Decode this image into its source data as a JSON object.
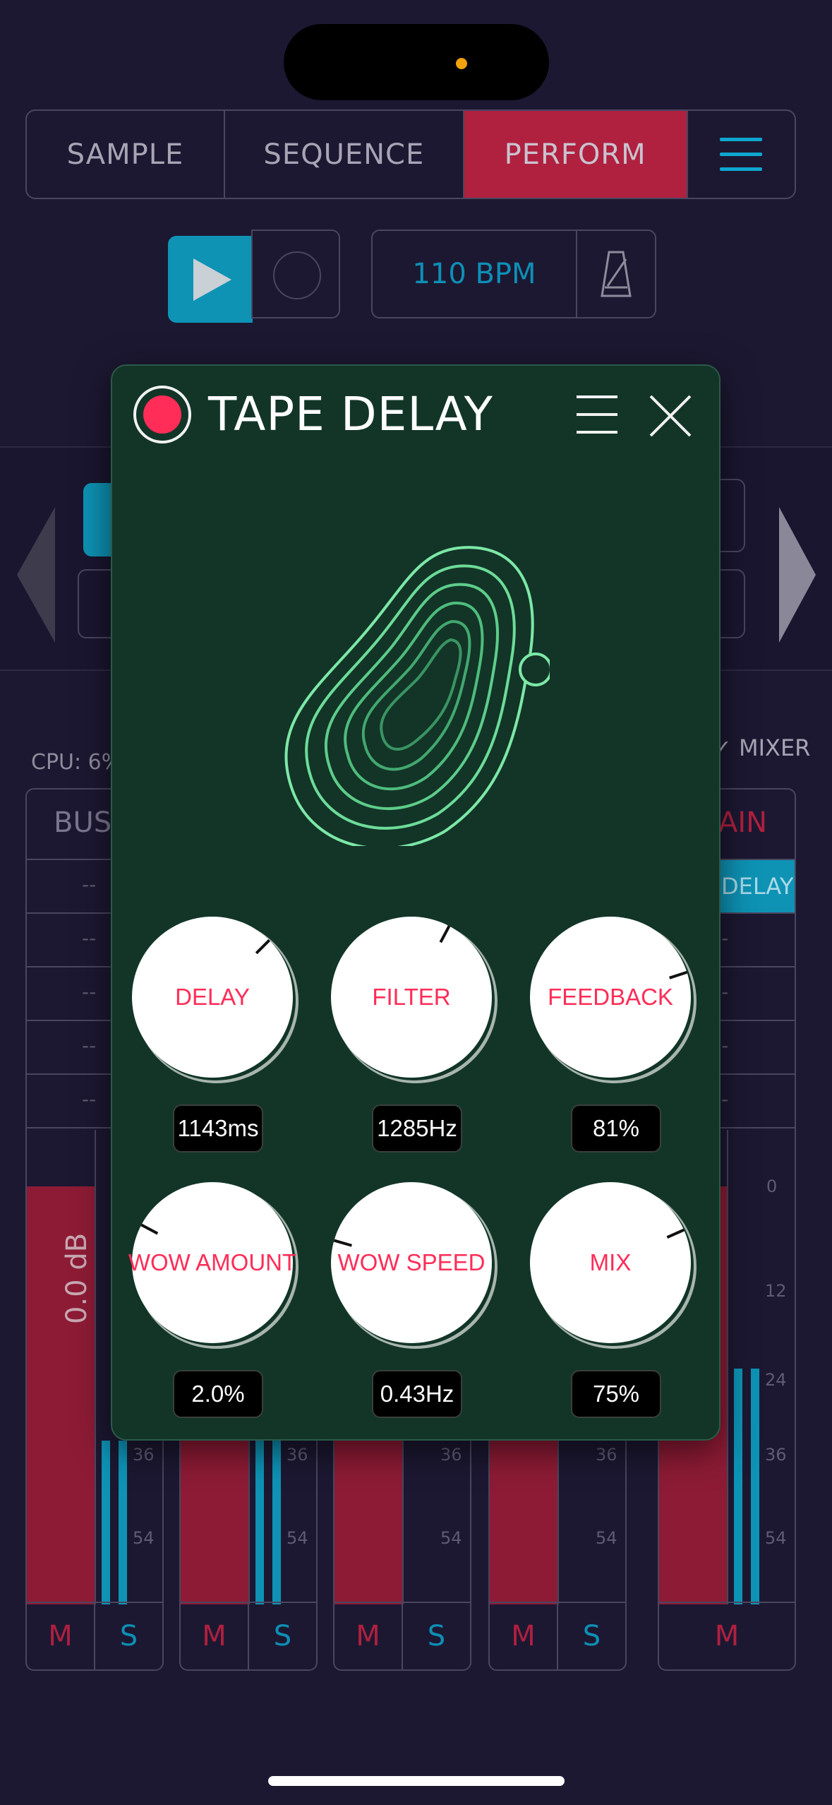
{
  "top_tabs": {
    "sample": "SAMPLE",
    "sequence": "SEQUENCE",
    "perform": "PERFORM"
  },
  "transport": {
    "bpm": "110 BPM"
  },
  "status": {
    "cpu": "CPU: 6%",
    "mixer": "✓ MIXER"
  },
  "mixer": {
    "bus_label": "BUS",
    "main_label": "AIN",
    "slot_empty": "--",
    "delay_slot": "DELAY",
    "fader_value": "0.0 dB",
    "ticks": [
      "0",
      "12",
      "24",
      "36",
      "54"
    ],
    "mute": "M",
    "solo": "S"
  },
  "panel": {
    "title": "TAPE DELAY",
    "enabled": true,
    "accent": "#ff2d57",
    "knobs": [
      {
        "label": "DELAY",
        "value": "1143ms"
      },
      {
        "label": "FILTER",
        "value": "1285Hz"
      },
      {
        "label": "FEEDBACK",
        "value": "81%"
      },
      {
        "label": "WOW AMOUNT",
        "value": "2.0%"
      },
      {
        "label": "WOW SPEED",
        "value": "0.43Hz"
      },
      {
        "label": "MIX",
        "value": "75%"
      }
    ]
  }
}
